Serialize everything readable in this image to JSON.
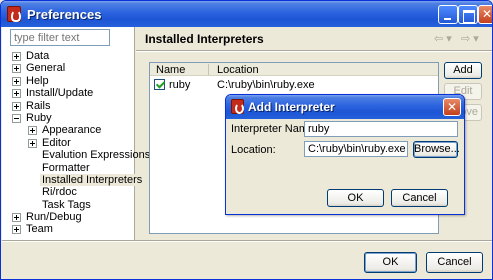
{
  "window": {
    "title": "Preferences",
    "minimize_label": "_",
    "maximize_label": "□",
    "close_label": "✕"
  },
  "sidebar": {
    "filter_placeholder": "type filter text",
    "items": [
      {
        "label": "Data",
        "expander": "plus"
      },
      {
        "label": "General",
        "expander": "plus"
      },
      {
        "label": "Help",
        "expander": "plus"
      },
      {
        "label": "Install/Update",
        "expander": "plus"
      },
      {
        "label": "Rails",
        "expander": "plus"
      },
      {
        "label": "Ruby",
        "expander": "minus"
      },
      {
        "label": "Appearance",
        "expander": "plus"
      },
      {
        "label": "Editor",
        "expander": "plus"
      },
      {
        "label": "Evalution Expressions",
        "expander": "none"
      },
      {
        "label": "Formatter",
        "expander": "none"
      },
      {
        "label": "Installed Interpreters",
        "expander": "none",
        "selected": true
      },
      {
        "label": "Ri/rdoc",
        "expander": "none"
      },
      {
        "label": "Task Tags",
        "expander": "none"
      },
      {
        "label": "Run/Debug",
        "expander": "plus"
      },
      {
        "label": "Team",
        "expander": "plus"
      }
    ]
  },
  "main": {
    "title": "Installed Interpreters",
    "back_arrow": "⇦ ▾",
    "forward_arrow": "⇨ ▾",
    "table": {
      "columns": [
        "Name",
        "Location"
      ],
      "rows": [
        {
          "checked": true,
          "name": "ruby",
          "location": "C:\\ruby\\bin\\ruby.exe"
        }
      ]
    },
    "buttons": {
      "add": "Add",
      "edit": "Edit",
      "remove": "ove"
    }
  },
  "footer": {
    "ok": "OK",
    "cancel": "Cancel"
  },
  "dialog": {
    "title": "Add Interpreter",
    "close_label": "✕",
    "name_label": "Interpreter Name:",
    "name_value": "ruby",
    "location_label": "Location:",
    "location_value": "C:\\ruby\\bin\\ruby.exe",
    "browse": "Browse...",
    "ok": "OK",
    "cancel": "Cancel"
  },
  "colors": {
    "titlebar": "#2b63df",
    "window_bg": "#ece9d8",
    "close_button": "#c2401f",
    "app_icon": "#c32b1a"
  }
}
